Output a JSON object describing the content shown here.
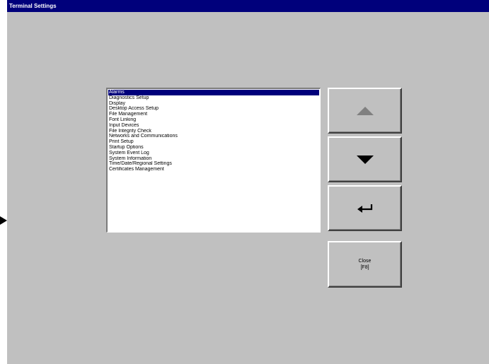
{
  "window": {
    "title": "Terminal Settings",
    "accent_color": "#00007b",
    "background_color": "#c0c0c0"
  },
  "menu": {
    "selected_index": 0,
    "items": [
      "Alarms",
      "Diagnostics Setup",
      "Display",
      "Desktop Access Setup",
      "File Management",
      "Font Linking",
      "Input Devices",
      "File Integrity Check",
      "Networks and Communications",
      "Print Setup",
      "Startup Options",
      "System Event Log",
      "System Information",
      "Time/Date/Regional Settings",
      "Certificates Management"
    ]
  },
  "buttons": {
    "up_icon": "triangle-up-icon",
    "down_icon": "triangle-down-icon",
    "enter_icon": "enter-arrow-icon",
    "close_label": "Close",
    "close_key": "[F8]"
  },
  "pointer": {
    "icon": "triangle-right-icon"
  }
}
